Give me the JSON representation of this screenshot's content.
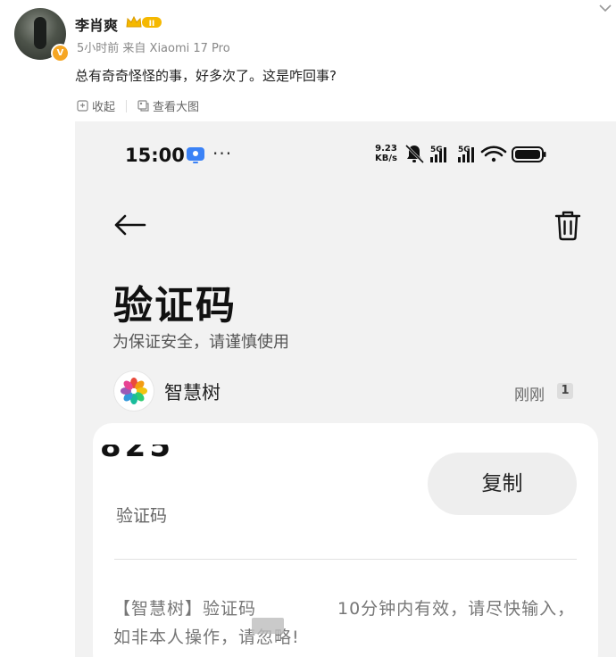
{
  "post": {
    "username": "李肖爽",
    "vip_level": "II",
    "meta": "5小时前  来自 Xiaomi 17 Pro",
    "text": "总有奇奇怪怪的事，好多次了。这是咋回事?",
    "actions": {
      "favorite": "收起",
      "view_large": "查看大图"
    }
  },
  "screenshot": {
    "status_bar": {
      "time": "15:00",
      "more": "···",
      "speed_value": "9.23",
      "speed_unit": "KB/s",
      "network_1": "5G",
      "network_2": "5G"
    },
    "page": {
      "title": "验证码",
      "subtitle": "为保证安全，请谨慎使用"
    },
    "sender": {
      "name": "智慧树",
      "time": "刚刚",
      "sim": "1"
    },
    "card": {
      "code_fragment": "825",
      "copy_label": "复制",
      "label": "验证码",
      "message_line1": "【智慧树】验证码",
      "message_tail": "10分钟内有效，请尽快输入，",
      "message_line2": "如非本人操作，请忽略!"
    }
  },
  "colors": {
    "accent_orange": "#f6a623",
    "badge_gold": "#f5b800"
  }
}
